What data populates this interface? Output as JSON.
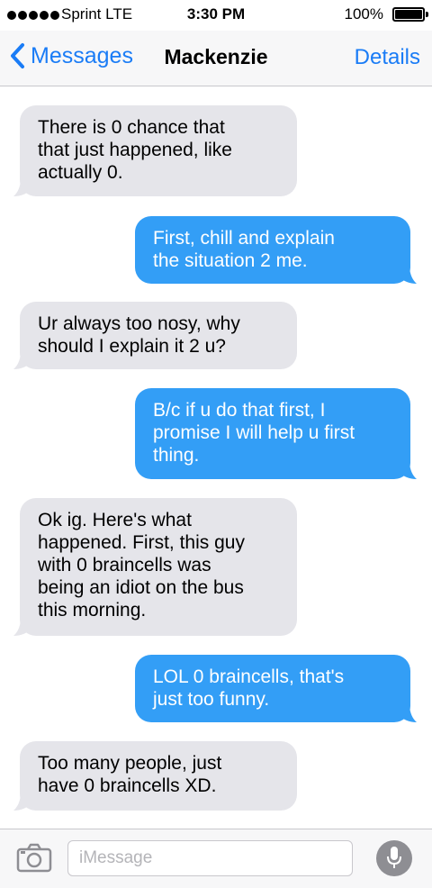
{
  "status_bar": {
    "carrier": "Sprint  LTE",
    "time": "3:30 PM",
    "battery": "100%",
    "signal_bars": 5
  },
  "nav": {
    "back_label": "Messages",
    "title": "Mackenzie",
    "details_label": "Details"
  },
  "messages": [
    {
      "direction": "received",
      "text": "There is 0 chance that\nthat just happened, like\nactually 0."
    },
    {
      "direction": "sent",
      "text": "First, chill and explain\nthe situation 2 me."
    },
    {
      "direction": "received",
      "text": "Ur always too nosy, why\nshould I explain it 2 u?"
    },
    {
      "direction": "sent",
      "text": "B/c if u do that first, I\npromise I will help u first\nthing."
    },
    {
      "direction": "received",
      "text": "Ok ig. Here's what\nhappened. First, this guy\nwith 0 braincells was\nbeing an idiot on the bus\nthis morning."
    },
    {
      "direction": "sent",
      "text": "LOL 0 braincells, that's\njust too funny."
    },
    {
      "direction": "received",
      "text": "Too many people, just\nhave 0 braincells XD."
    }
  ],
  "compose": {
    "placeholder": "iMessage",
    "value": ""
  },
  "colors": {
    "accent": "#1a7cf6",
    "sent_bubble": "#339ef6",
    "received_bubble": "#e5e5ea"
  },
  "icons": {
    "back": "chevron-left-icon",
    "camera": "camera-icon",
    "mic": "microphone-icon"
  }
}
